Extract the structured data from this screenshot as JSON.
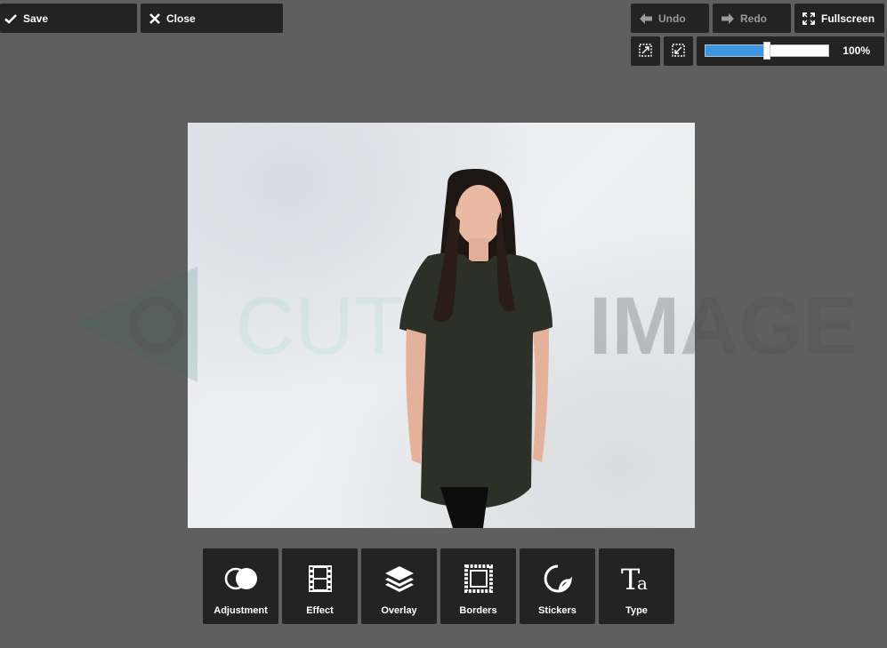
{
  "toolbar": {
    "save_label": "Save",
    "close_label": "Close",
    "undo_label": "Undo",
    "redo_label": "Redo",
    "fullscreen_label": "Fullscreen"
  },
  "zoom": {
    "value_label": "100%",
    "level": 0.5
  },
  "watermark": {
    "text_left": "CUT",
    "text_right": "IMAGE"
  },
  "tools": [
    {
      "label": "Adjustment",
      "icon": "adjustment-icon"
    },
    {
      "label": "Effect",
      "icon": "film-strip-icon"
    },
    {
      "label": "Overlay",
      "icon": "layers-icon"
    },
    {
      "label": "Borders",
      "icon": "stamp-border-icon"
    },
    {
      "label": "Stickers",
      "icon": "sticker-icon"
    },
    {
      "label": "Type",
      "icon": "type-icon"
    }
  ],
  "colors": {
    "background": "#5f5f5f",
    "button": "#232323",
    "accent": "#3b97e3",
    "disabled_text": "#9a9a9a"
  }
}
